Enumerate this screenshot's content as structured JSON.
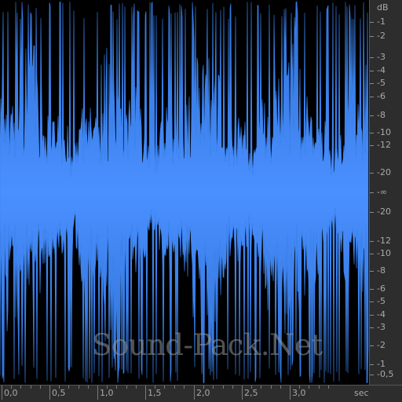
{
  "db_ruler": {
    "unit": "dB",
    "labels": [
      "-1",
      "-2",
      "-3",
      "-4",
      "-5",
      "-6",
      "-8",
      "-10",
      "-12",
      "-20",
      "-∞",
      "-20",
      "-12",
      "-10",
      "-8",
      "-6",
      "-5",
      "-4",
      "-3",
      "-2",
      "-1",
      "-0,5"
    ]
  },
  "time_ruler": {
    "labels": [
      "0,0",
      "0,5",
      "1,0",
      "1,5",
      "2,0",
      "2,5",
      "3,0"
    ],
    "unit": "sec"
  },
  "watermark": "Sound-Pack.Net",
  "colors": {
    "waveform_fill": "#3b84ee",
    "waveform_bright": "#4a90ff",
    "background": "#000000",
    "ruler_bg": "#2d2d2d",
    "ruler_text": "#a9a9a9"
  }
}
